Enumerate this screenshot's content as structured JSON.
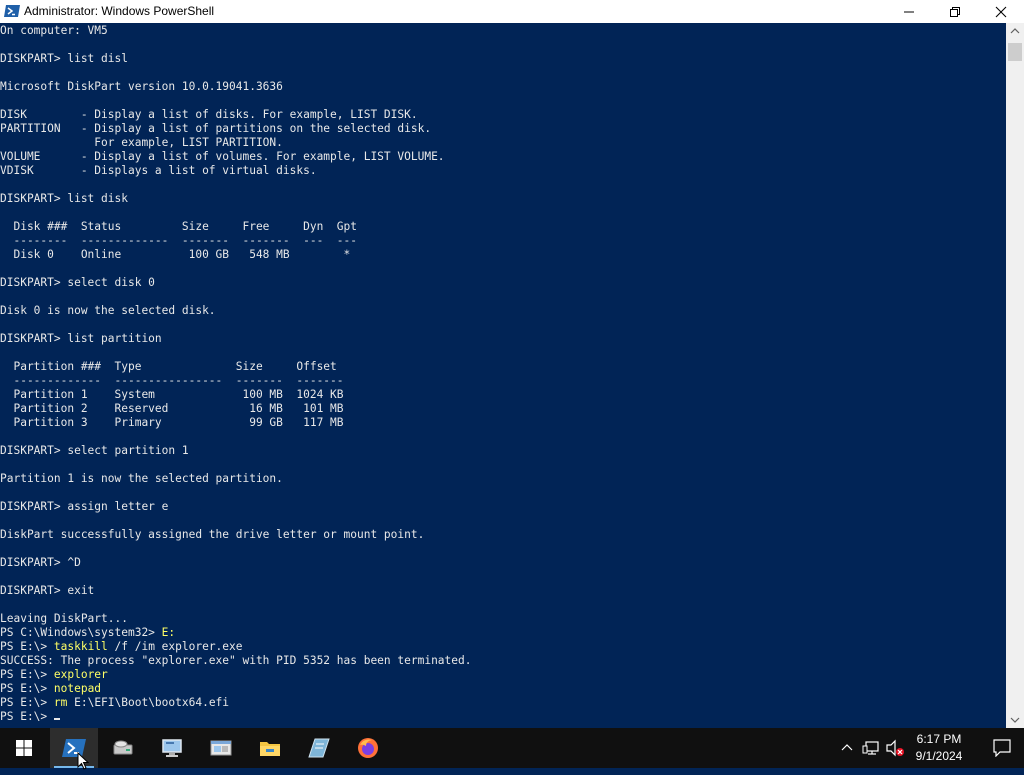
{
  "window": {
    "title": "Administrator: Windows PowerShell",
    "icon": "powershell-icon",
    "controls": [
      "minimize-icon",
      "restore-icon",
      "close-icon"
    ]
  },
  "console": {
    "lines": [
      [
        {
          "t": "On computer: VM5",
          "c": "text"
        }
      ],
      [
        {
          "t": "",
          "c": "text"
        }
      ],
      [
        {
          "t": "DISKPART> list disl",
          "c": "text"
        }
      ],
      [
        {
          "t": "",
          "c": "text"
        }
      ],
      [
        {
          "t": "Microsoft DiskPart version 10.0.19041.3636",
          "c": "text"
        }
      ],
      [
        {
          "t": "",
          "c": "text"
        }
      ],
      [
        {
          "t": "DISK        - Display a list of disks. For example, LIST DISK.",
          "c": "text"
        }
      ],
      [
        {
          "t": "PARTITION   - Display a list of partitions on the selected disk.",
          "c": "text"
        }
      ],
      [
        {
          "t": "              For example, LIST PARTITION.",
          "c": "text"
        }
      ],
      [
        {
          "t": "VOLUME      - Display a list of volumes. For example, LIST VOLUME.",
          "c": "text"
        }
      ],
      [
        {
          "t": "VDISK       - Displays a list of virtual disks.",
          "c": "text"
        }
      ],
      [
        {
          "t": "",
          "c": "text"
        }
      ],
      [
        {
          "t": "DISKPART> list disk",
          "c": "text"
        }
      ],
      [
        {
          "t": "",
          "c": "text"
        }
      ],
      [
        {
          "t": "  Disk ###  Status         Size     Free     Dyn  Gpt",
          "c": "text"
        }
      ],
      [
        {
          "t": "  --------  -------------  -------  -------  ---  ---",
          "c": "text"
        }
      ],
      [
        {
          "t": "  Disk 0    Online          100 GB   548 MB        *",
          "c": "text"
        }
      ],
      [
        {
          "t": "",
          "c": "text"
        }
      ],
      [
        {
          "t": "DISKPART> select disk 0",
          "c": "text"
        }
      ],
      [
        {
          "t": "",
          "c": "text"
        }
      ],
      [
        {
          "t": "Disk 0 is now the selected disk.",
          "c": "text"
        }
      ],
      [
        {
          "t": "",
          "c": "text"
        }
      ],
      [
        {
          "t": "DISKPART> list partition",
          "c": "text"
        }
      ],
      [
        {
          "t": "",
          "c": "text"
        }
      ],
      [
        {
          "t": "  Partition ###  Type              Size     Offset",
          "c": "text"
        }
      ],
      [
        {
          "t": "  -------------  ----------------  -------  -------",
          "c": "text"
        }
      ],
      [
        {
          "t": "  Partition 1    System             100 MB  1024 KB",
          "c": "text"
        }
      ],
      [
        {
          "t": "  Partition 2    Reserved            16 MB   101 MB",
          "c": "text"
        }
      ],
      [
        {
          "t": "  Partition 3    Primary             99 GB   117 MB",
          "c": "text"
        }
      ],
      [
        {
          "t": "",
          "c": "text"
        }
      ],
      [
        {
          "t": "DISKPART> select partition 1",
          "c": "text"
        }
      ],
      [
        {
          "t": "",
          "c": "text"
        }
      ],
      [
        {
          "t": "Partition 1 is now the selected partition.",
          "c": "text"
        }
      ],
      [
        {
          "t": "",
          "c": "text"
        }
      ],
      [
        {
          "t": "DISKPART> assign letter e",
          "c": "text"
        }
      ],
      [
        {
          "t": "",
          "c": "text"
        }
      ],
      [
        {
          "t": "DiskPart successfully assigned the drive letter or mount point.",
          "c": "text"
        }
      ],
      [
        {
          "t": "",
          "c": "text"
        }
      ],
      [
        {
          "t": "DISKPART> ^D",
          "c": "text"
        }
      ],
      [
        {
          "t": "",
          "c": "text"
        }
      ],
      [
        {
          "t": "DISKPART> exit",
          "c": "text"
        }
      ],
      [
        {
          "t": "",
          "c": "text"
        }
      ],
      [
        {
          "t": "Leaving DiskPart...",
          "c": "text"
        }
      ],
      [
        {
          "t": "PS C:\\Windows\\system32> ",
          "c": "prompt"
        },
        {
          "t": "E:",
          "c": "cmd"
        }
      ],
      [
        {
          "t": "PS E:\\> ",
          "c": "prompt"
        },
        {
          "t": "taskkill",
          "c": "cmd"
        },
        {
          "t": " /f /im explorer.exe",
          "c": "arg"
        }
      ],
      [
        {
          "t": "SUCCESS: The process \"explorer.exe\" with PID 5352 has been terminated.",
          "c": "text"
        }
      ],
      [
        {
          "t": "PS E:\\> ",
          "c": "prompt"
        },
        {
          "t": "explorer",
          "c": "cmd"
        }
      ],
      [
        {
          "t": "PS E:\\> ",
          "c": "prompt"
        },
        {
          "t": "notepad",
          "c": "cmd"
        }
      ],
      [
        {
          "t": "PS E:\\> ",
          "c": "prompt"
        },
        {
          "t": "rm",
          "c": "cmd"
        },
        {
          "t": " E:\\EFI\\Boot\\bootx64.efi",
          "c": "arg"
        }
      ],
      [
        {
          "t": "PS E:\\> ",
          "c": "prompt"
        },
        {
          "t": "",
          "c": "cursor"
        }
      ]
    ]
  },
  "taskbar": {
    "items": [
      {
        "name": "start-button",
        "icon": "windows-icon"
      },
      {
        "name": "taskbar-powershell",
        "icon": "powershell-icon",
        "active": true
      },
      {
        "name": "taskbar-app-2",
        "icon": "drive-icon"
      },
      {
        "name": "taskbar-app-3",
        "icon": "monitor-icon"
      },
      {
        "name": "taskbar-app-4",
        "icon": "network-window-icon"
      },
      {
        "name": "taskbar-file-explorer",
        "icon": "folder-icon"
      },
      {
        "name": "taskbar-app-6",
        "icon": "notebook-icon"
      },
      {
        "name": "taskbar-firefox",
        "icon": "firefox-icon"
      }
    ],
    "tray": [
      "chevron-up-icon",
      "network-icon",
      "speaker-muted-icon"
    ],
    "clock": {
      "time": "6:17 PM",
      "date": "9/1/2024"
    },
    "notification_icon": "notification-icon"
  },
  "colors": {
    "console_bg": "#012456",
    "console_text": "#e8e8e8",
    "command": "#ffff66",
    "taskbar_bg": "#101010",
    "accent": "#76b9ed"
  }
}
